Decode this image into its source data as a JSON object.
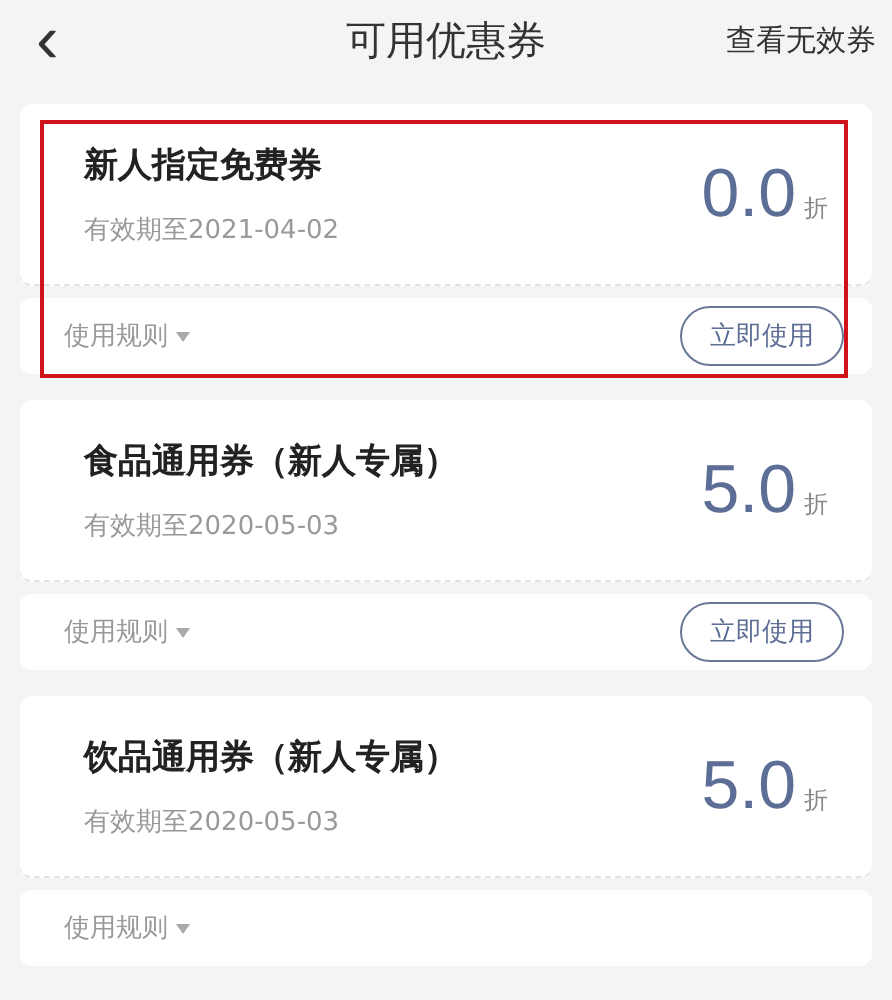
{
  "header": {
    "back_icon": "‹",
    "title": "可用优惠券",
    "action": "查看无效券"
  },
  "coupons": [
    {
      "name": "新人指定免费券",
      "validity": "有效期至2021-04-02",
      "discount": "0.0",
      "unit": "折",
      "rules": "使用规则",
      "button": "立即使用",
      "highlighted": true
    },
    {
      "name": "食品通用券（新人专属）",
      "validity": "有效期至2020-05-03",
      "discount": "5.0",
      "unit": "折",
      "rules": "使用规则",
      "button": "立即使用",
      "highlighted": false
    },
    {
      "name": "饮品通用券（新人专属）",
      "validity": "有效期至2020-05-03",
      "discount": "5.0",
      "unit": "折",
      "rules": "使用规则",
      "highlighted": false
    }
  ]
}
